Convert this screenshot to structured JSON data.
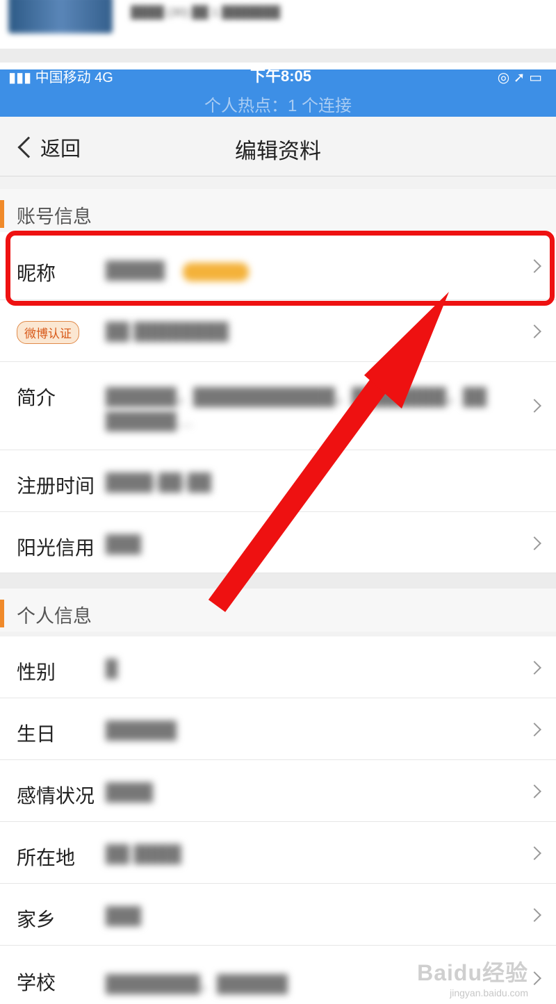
{
  "prev_screenshot": {
    "text": "████ (30) ██ 1 ███████"
  },
  "status_bar": {
    "carrier": "▮▮▮ 中国移动 4G",
    "time": "下午8:05",
    "right_icons": "◎ ➚ ▭",
    "hotspot": "个人热点：1 个连接"
  },
  "nav": {
    "back_label": "返回",
    "title": "编辑资料"
  },
  "account_section": {
    "title": "账号信息",
    "rows": [
      {
        "label": "昵称",
        "value": "█████",
        "badge": "█████"
      },
      {
        "label": "微博认证",
        "value": "██ ████████"
      },
      {
        "label": "简介",
        "value": "██████，████████████，████████，██",
        "value2": "██████…"
      },
      {
        "label": "注册时间",
        "value": "████-██-██"
      },
      {
        "label": "阳光信用",
        "value": "███"
      }
    ]
  },
  "personal_section": {
    "title": "个人信息",
    "rows": [
      {
        "label": "性别",
        "value": "█"
      },
      {
        "label": "生日",
        "value": "██████"
      },
      {
        "label": "感情状况",
        "value": "████"
      },
      {
        "label": "所在地",
        "value": "██ ████"
      },
      {
        "label": "家乡",
        "value": "███"
      },
      {
        "label": "学校",
        "value": "████████、██████"
      }
    ]
  },
  "colors": {
    "annotation": "#ee1111",
    "status_bar": "#3d8fe6",
    "section_accent": "#f08a2a"
  },
  "watermark": {
    "logo": "Baidu经验",
    "url": "jingyan.baidu.com"
  }
}
